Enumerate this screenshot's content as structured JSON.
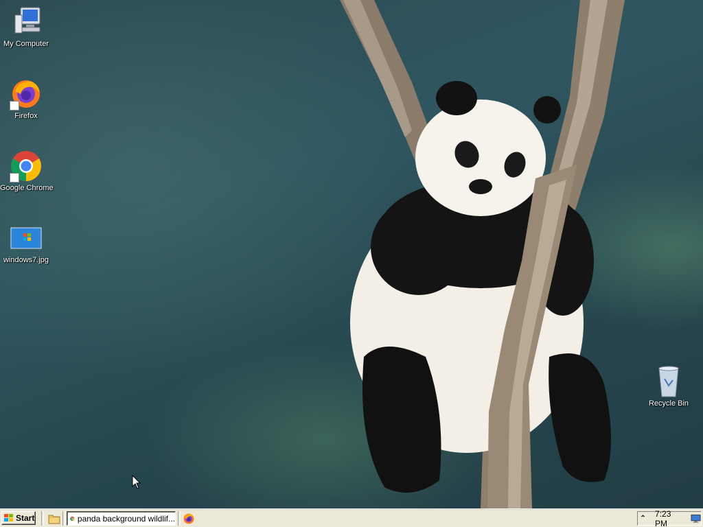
{
  "desktop": {
    "icons": [
      {
        "label": "My Computer",
        "icon": "my-computer-icon"
      },
      {
        "label": "Firefox",
        "icon": "firefox-icon"
      },
      {
        "label": "Google Chrome",
        "icon": "chrome-icon"
      },
      {
        "label": "windows7.jpg",
        "icon": "image-file-icon"
      },
      {
        "label": "Recycle Bin",
        "icon": "recycle-bin-icon"
      }
    ]
  },
  "taskbar": {
    "start_label": "Start",
    "quick_launch": [
      "file-manager-icon"
    ],
    "tasks": [
      {
        "title": "panda background wildlif...",
        "icon": "chrome-icon"
      },
      {
        "title": "",
        "icon": "firefox-icon"
      }
    ],
    "tray": {
      "clock": "7:23 PM",
      "icons": [
        "show-hidden-icons-chevron",
        "monitor-icon"
      ]
    }
  }
}
